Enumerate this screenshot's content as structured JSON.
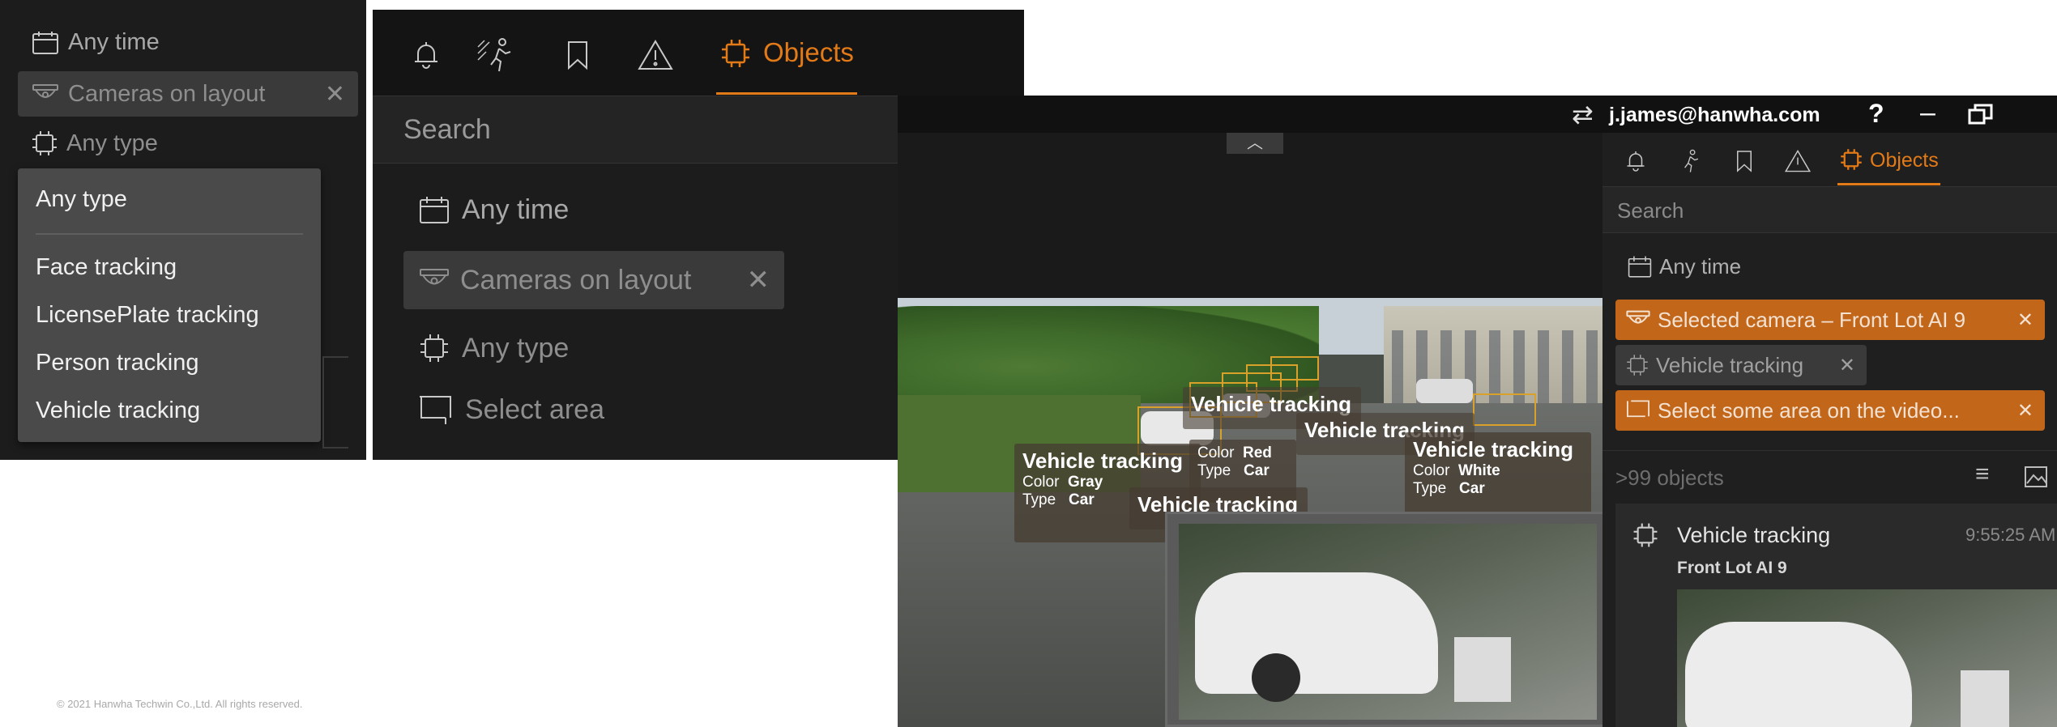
{
  "panel1": {
    "filters": {
      "time": "Any time",
      "cameras": "Cameras on layout",
      "type": "Any type"
    },
    "dropdown": {
      "selected": "Any type",
      "options": [
        "Face tracking",
        "LicensePlate tracking",
        "Person tracking",
        "Vehicle tracking"
      ]
    }
  },
  "panel2": {
    "tabs": {
      "objects_label": "Objects"
    },
    "search_placeholder": "Search",
    "filters": {
      "time": "Any time",
      "cameras": "Cameras on layout",
      "type": "Any type",
      "area": "Select area"
    }
  },
  "client": {
    "account": "j.james@hanwha.com",
    "help": "?",
    "sidebar": {
      "objects_label": "Objects",
      "search_placeholder": "Search",
      "filters": {
        "time": "Any time",
        "camera": "Selected camera – Front Lot AI 9",
        "type": "Vehicle tracking",
        "area": "Select some area on the video..."
      },
      "count_label": ">99 objects",
      "result": {
        "title": "Vehicle tracking",
        "time": "9:55:25 AM",
        "camera": "Front Lot AI 9"
      }
    },
    "video_labels": {
      "label1": {
        "title": "Vehicle tracking",
        "color_key": "Color",
        "color_val": "Gray",
        "type_key": "Type",
        "type_val": "Car"
      },
      "label2": {
        "title": "Vehicle tracking"
      },
      "label3": {
        "title": "Vehicle tracking"
      },
      "label4": {
        "title": "Vehicle tracking",
        "color_key": "Color",
        "color_val": "White",
        "type_key": "Type",
        "type_val": "Car"
      },
      "label5": {
        "color_key": "Color",
        "color_val": "Red",
        "type_key": "Type",
        "type_val": "Car"
      },
      "label6": {
        "title": "Vehicle tracking"
      }
    }
  },
  "footer": {
    "copyright": "© 2021 Hanwha Techwin Co.,Ltd. All rights reserved."
  },
  "colors": {
    "accent": "#e37a18",
    "panel": "#1f1f1f",
    "chip": "#3a3a3a",
    "chip_active": "#c2661a"
  }
}
